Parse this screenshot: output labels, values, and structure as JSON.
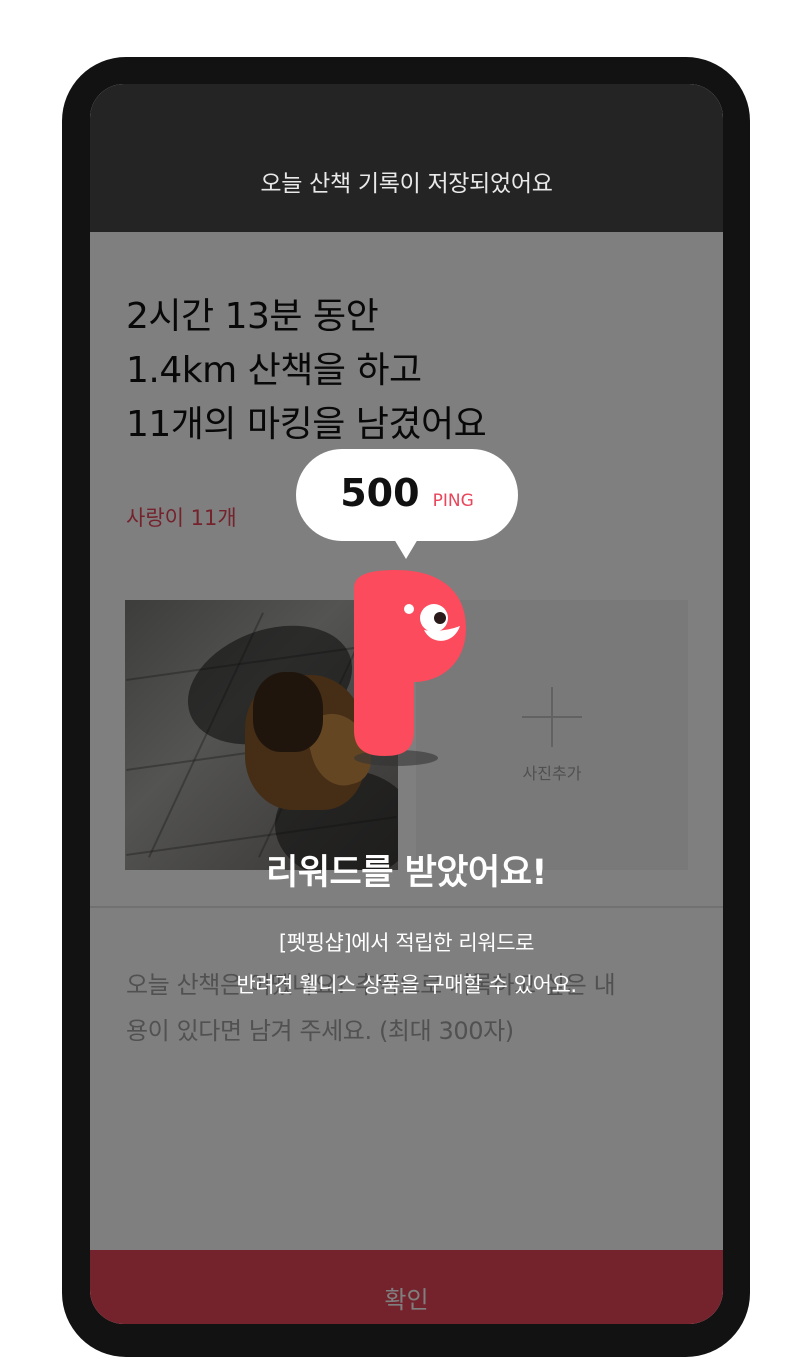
{
  "header": {
    "title": "오늘 산책 기록이 저장되었어요"
  },
  "summary": {
    "line1": "2시간 13분 동안",
    "line2": "1.4km 산책을 하고",
    "line3": "11개의 마킹을 남겼어요"
  },
  "marking": {
    "love_count": "사랑이 11개"
  },
  "photos": {
    "add_label": "사진추가"
  },
  "memo": {
    "placeholder_line1": "오늘 산책은 어땠나요? 추억으로 기록하고 싶은 내",
    "placeholder_line2": "용이 있다면 남겨 주세요. (최대 300자)"
  },
  "confirm": {
    "label": "확인"
  },
  "reward": {
    "points_value": "500",
    "points_unit": "PING",
    "title": "리워드를 받았어요!",
    "desc_line1": "[펫핑샵]에서 적립한 리워드로",
    "desc_line2": "반려견 웰니스 상품을 구매할 수 있어요."
  },
  "colors": {
    "accent": "#e8465b",
    "header_bg": "#242424",
    "frame": "#121212"
  },
  "icons": {
    "mascot": "ping-mascot-icon",
    "add_photo": "plus-icon"
  }
}
